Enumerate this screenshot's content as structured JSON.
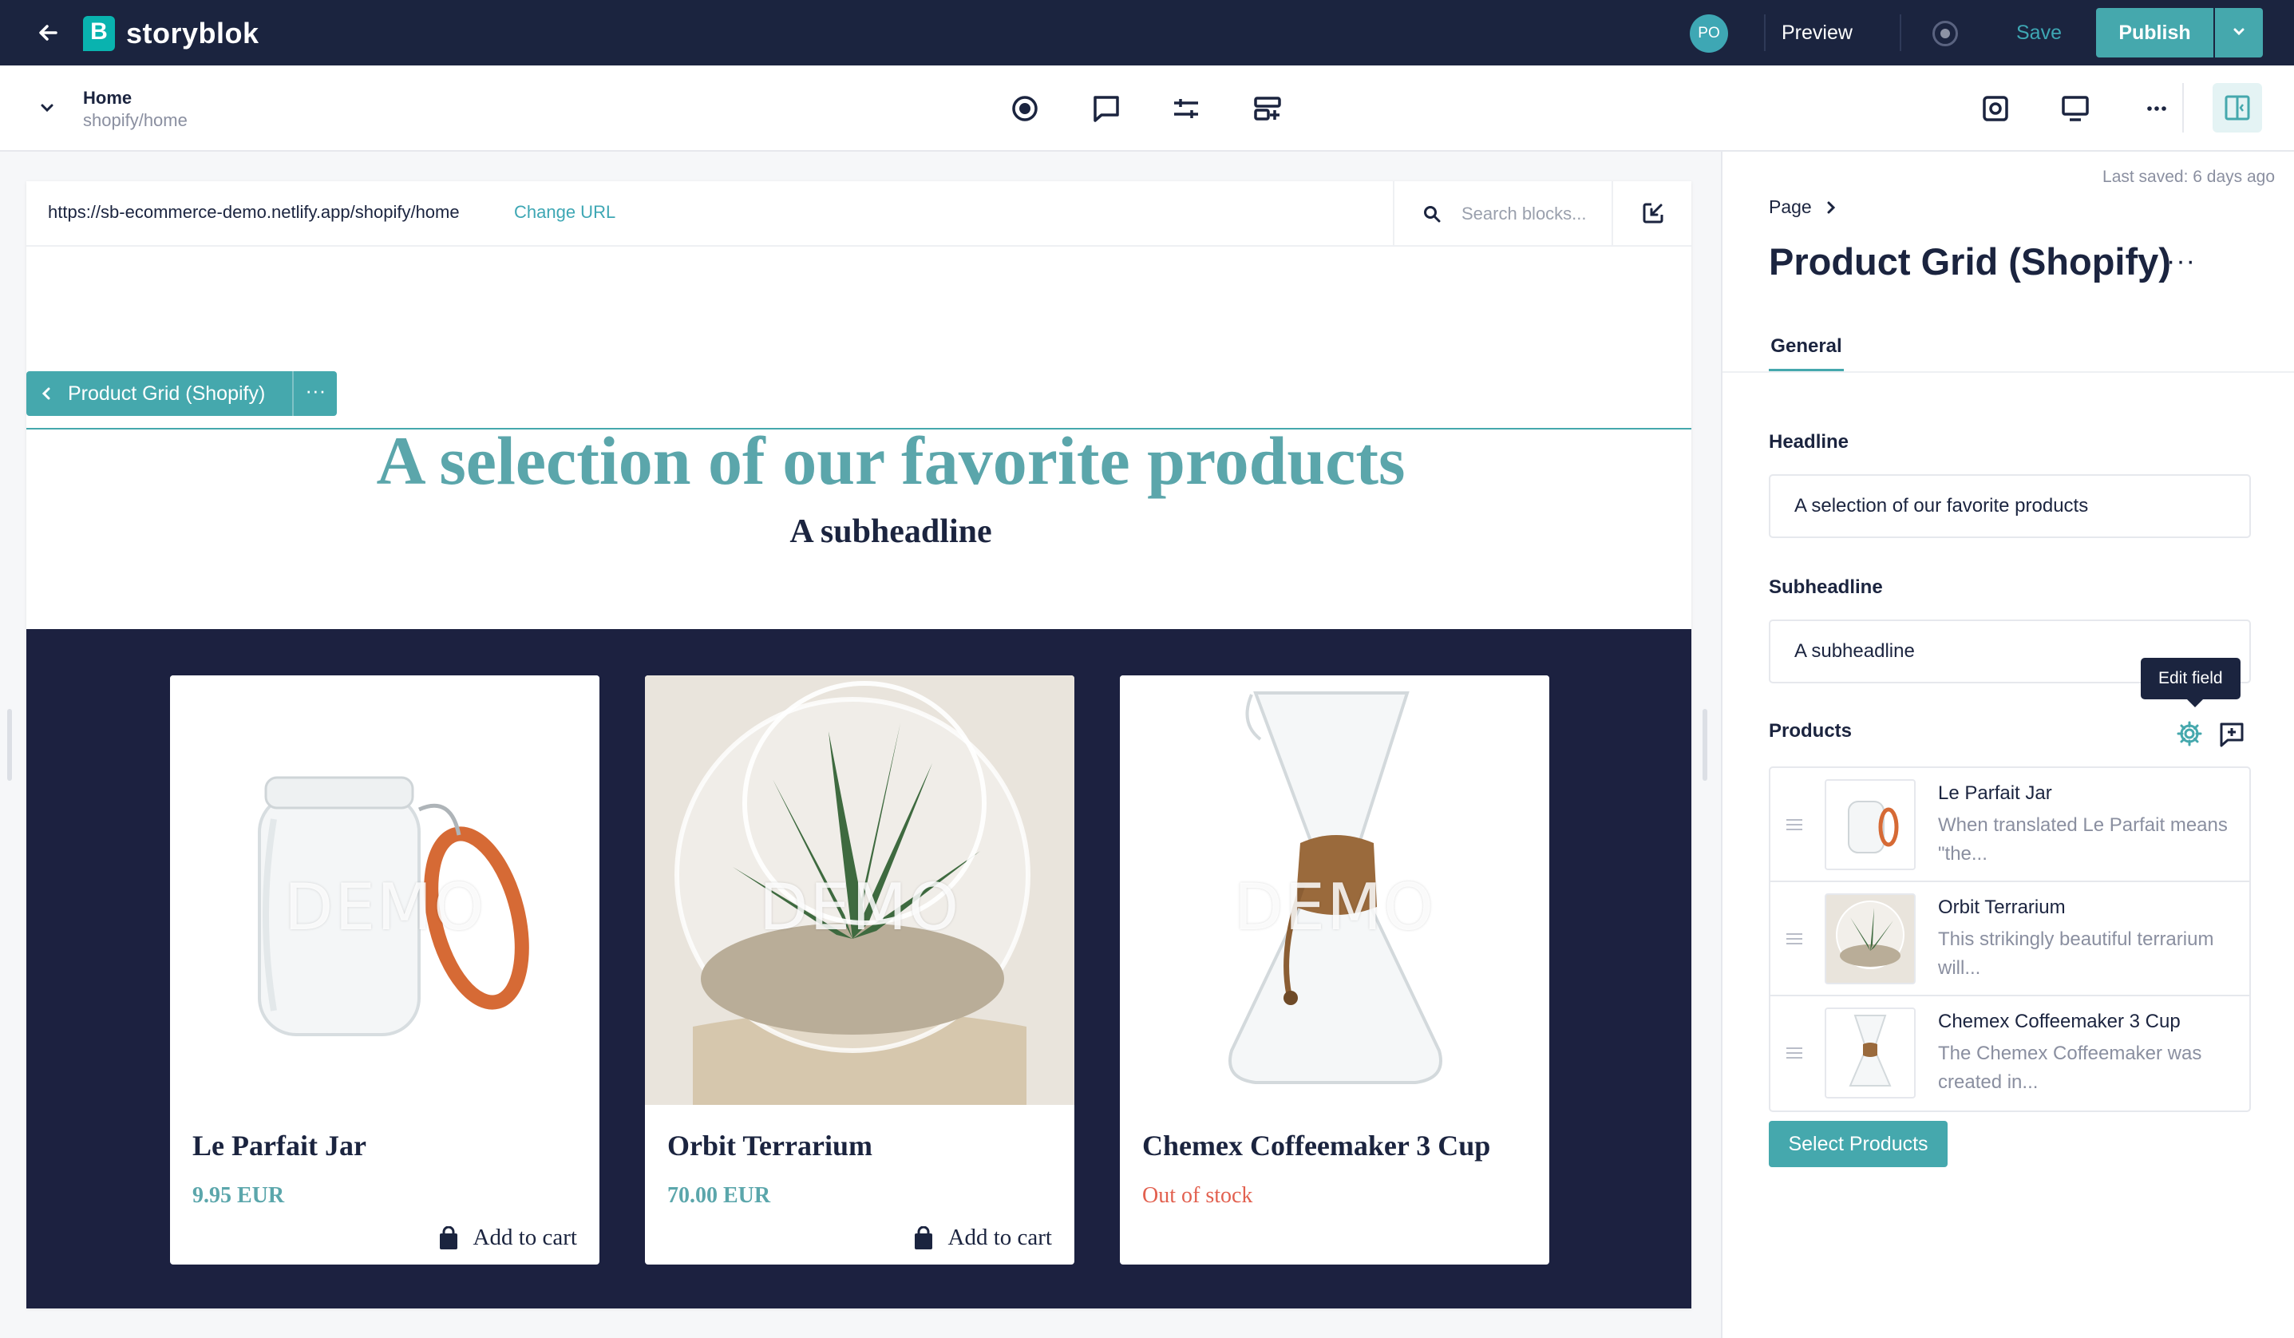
{
  "app": {
    "brand": "storyblok",
    "user_initials": "PO",
    "preview_label": "Preview",
    "save_label": "Save",
    "publish_label": "Publish",
    "accent_color": "#45a8ad",
    "dark_color": "#1b243f"
  },
  "story": {
    "title": "Home",
    "slug": "shopify/home"
  },
  "toolbar_icons": [
    "target-icon",
    "comment-icon",
    "sliders-icon",
    "add-block-icon"
  ],
  "toolbar_right_icons": [
    "screenshot-icon",
    "desktop-icon",
    "more-icon",
    "toggle-panel-icon"
  ],
  "preview": {
    "url": "https://sb-ecommerce-demo.netlify.app/shopify/home",
    "change_url_label": "Change URL",
    "search_placeholder": "Search blocks...",
    "block_label": "Product Grid (Shopify)",
    "block_more": "···",
    "headline": "A selection of our favorite products",
    "subheadline": "A subheadline",
    "watermark": "DEMO",
    "products": [
      {
        "name": "Le Parfait Jar",
        "price": "9.95 EUR",
        "cart_label": "Add to cart"
      },
      {
        "name": "Orbit Terrarium",
        "price": "70.00 EUR",
        "cart_label": "Add to cart"
      },
      {
        "name": "Chemex Coffeemaker 3 Cup",
        "status": "Out of stock"
      }
    ]
  },
  "panel": {
    "last_saved": "Last saved: 6 days ago",
    "breadcrumb": "Page",
    "title": "Product Grid (Shopify)",
    "title_more": "···",
    "tab": "General",
    "headline_label": "Headline",
    "headline_value": "A selection of our favorite products",
    "subheadline_label": "Subheadline",
    "subheadline_value": "A subheadline",
    "products_label": "Products",
    "tooltip": "Edit field",
    "products": [
      {
        "name": "Le Parfait Jar",
        "desc": "When translated Le Parfait means \"the..."
      },
      {
        "name": "Orbit Terrarium",
        "desc": "This strikingly beautiful terrarium will..."
      },
      {
        "name": "Chemex Coffeemaker 3 Cup",
        "desc": "The Chemex Coffeemaker was created in..."
      }
    ],
    "select_products_label": "Select Products"
  }
}
